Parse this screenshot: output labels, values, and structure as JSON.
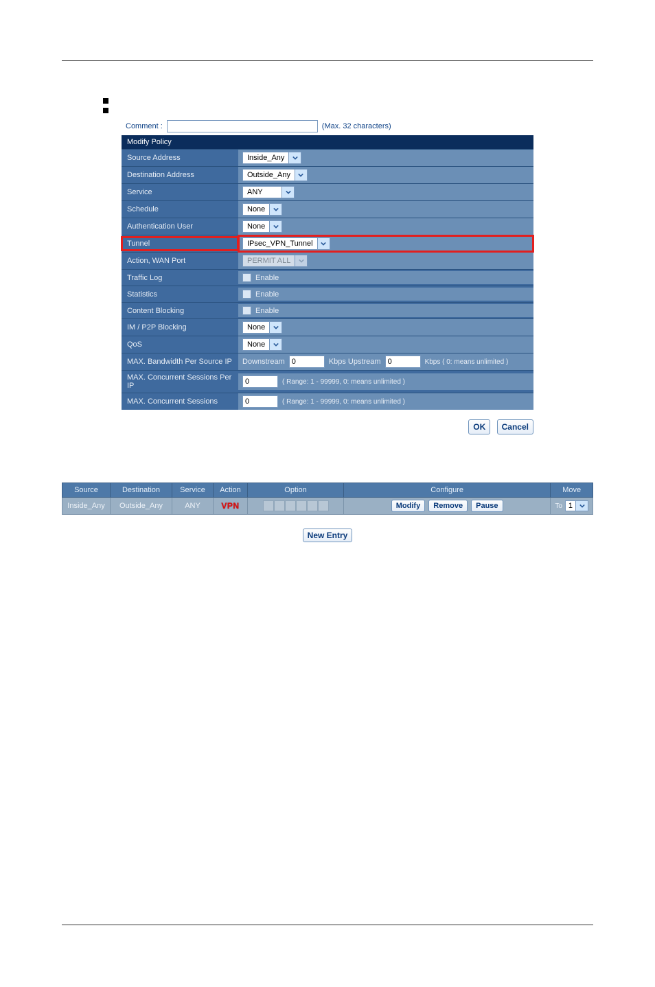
{
  "bullets": [
    "",
    ""
  ],
  "comment": {
    "label": "Comment :",
    "value": "",
    "hint": "(Max. 32 characters)"
  },
  "section_title": "Modify Policy",
  "rows": {
    "source_addr": {
      "label": "Source Address",
      "value": "Inside_Any"
    },
    "dest_addr": {
      "label": "Destination Address",
      "value": "Outside_Any"
    },
    "service": {
      "label": "Service",
      "value": "ANY"
    },
    "schedule": {
      "label": "Schedule",
      "value": "None"
    },
    "auth_user": {
      "label": "Authentication User",
      "value": "None"
    },
    "tunnel": {
      "label": "Tunnel",
      "value": "IPsec_VPN_Tunnel"
    },
    "action_wan": {
      "label": "Action, WAN Port",
      "value": "PERMIT ALL"
    },
    "traffic_log": {
      "label": "Traffic Log",
      "text": "Enable"
    },
    "statistics": {
      "label": "Statistics",
      "text": "Enable"
    },
    "content_blocking": {
      "label": "Content Blocking",
      "text": "Enable"
    },
    "im_p2p": {
      "label": "IM / P2P Blocking",
      "value": "None"
    },
    "qos": {
      "label": "QoS",
      "value": "None"
    },
    "max_bw": {
      "label": "MAX. Bandwidth Per Source IP",
      "down_label": "Downstream",
      "down_val": "0",
      "up_label": "Kbps Upstream",
      "up_val": "0",
      "suffix": "Kbps ( 0: means unlimited )"
    },
    "max_sess_ip": {
      "label": "MAX. Concurrent Sessions Per IP",
      "val": "0",
      "range": "( Range: 1 - 99999, 0: means unlimited )"
    },
    "max_sess": {
      "label": "MAX. Concurrent Sessions",
      "val": "0",
      "range": "( Range: 1 - 99999, 0: means unlimited )"
    }
  },
  "buttons": {
    "ok": "OK",
    "cancel": "Cancel",
    "new_entry": "New Entry"
  },
  "table": {
    "headers": [
      "Source",
      "Destination",
      "Service",
      "Action",
      "Option",
      "Configure",
      "Move"
    ],
    "row": {
      "source": "Inside_Any",
      "destination": "Outside_Any",
      "service": "ANY",
      "action": "VPN",
      "modify": "Modify",
      "remove": "Remove",
      "pause": "Pause",
      "move_to": "To",
      "move_val": "1"
    }
  }
}
